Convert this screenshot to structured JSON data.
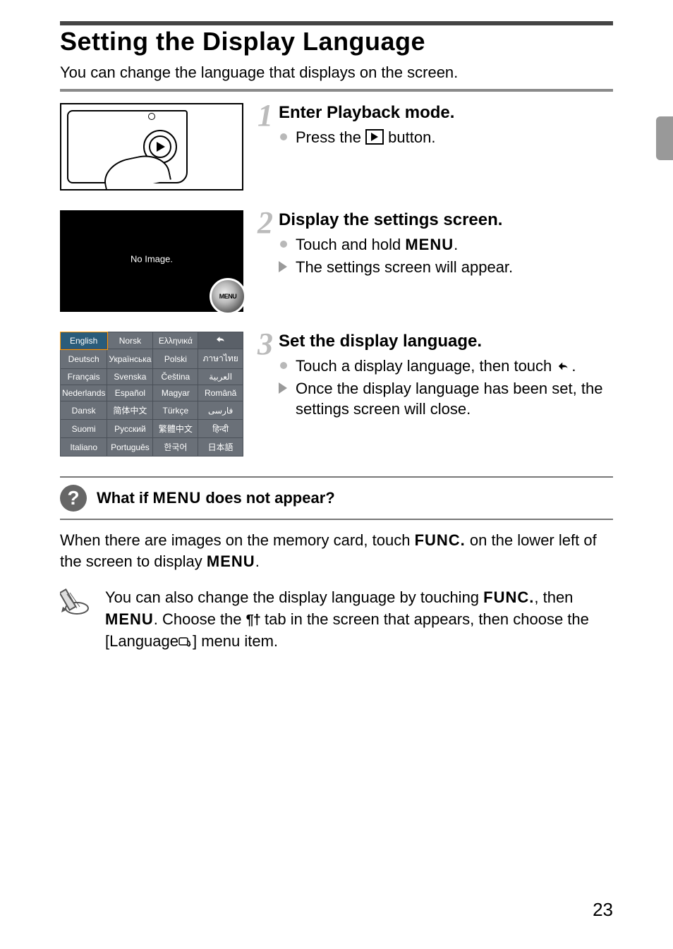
{
  "page_number": "23",
  "title": "Setting the Display Language",
  "intro": "You can change the language that displays on the screen.",
  "steps": [
    {
      "num": "1",
      "title": "Enter Playback mode.",
      "items": [
        {
          "kind": "dot",
          "pre": "Press the ",
          "glyph": "play",
          "post": " button."
        }
      ]
    },
    {
      "num": "2",
      "title": "Display the settings screen.",
      "items": [
        {
          "kind": "dot",
          "pre": "Touch and hold ",
          "glyph": "menu",
          "post": "."
        },
        {
          "kind": "arrow",
          "pre": "The settings screen will appear.",
          "glyph": "",
          "post": ""
        }
      ]
    },
    {
      "num": "3",
      "title": "Set the display language.",
      "items": [
        {
          "kind": "dot",
          "pre": "Touch a display language, then touch ",
          "glyph": "return",
          "post": "."
        },
        {
          "kind": "arrow",
          "pre": "Once the display language has been set, the settings screen will close.",
          "glyph": "",
          "post": ""
        }
      ]
    }
  ],
  "fig2_msg": "No Image.",
  "fig2_badge": "MENU",
  "lang_table": [
    [
      "English",
      "Norsk",
      "Ελληνικά",
      "↶"
    ],
    [
      "Deutsch",
      "Українська",
      "Polski",
      "ภาษาไทย"
    ],
    [
      "Français",
      "Svenska",
      "Čeština",
      "العربية"
    ],
    [
      "Nederlands",
      "Español",
      "Magyar",
      "Română"
    ],
    [
      "Dansk",
      "简体中文",
      "Türkçe",
      "فارسی"
    ],
    [
      "Suomi",
      "Русский",
      "繁體中文",
      "हिन्दी"
    ],
    [
      "Italiano",
      "Português",
      "한국어",
      "日本語"
    ]
  ],
  "q_title_pre": "What if ",
  "q_title_mid": "MENU",
  "q_title_post": " does not appear?",
  "q_body_pre": "When there are images on the memory card, touch ",
  "q_body_func": "FUNC.",
  "q_body_mid": " on the lower left of the screen to display ",
  "q_body_menu": "MENU",
  "q_body_post": ".",
  "tip_p1": "You can also change the display language by touching ",
  "tip_func": "FUNC.",
  "tip_p2": ", then ",
  "tip_menu": "MENU",
  "tip_p3": ". Choose the ",
  "tip_tools": "ƒ†",
  "tip_p4": " tab in the screen that appears, then choose the [Language",
  "tip_p5": "] menu item."
}
